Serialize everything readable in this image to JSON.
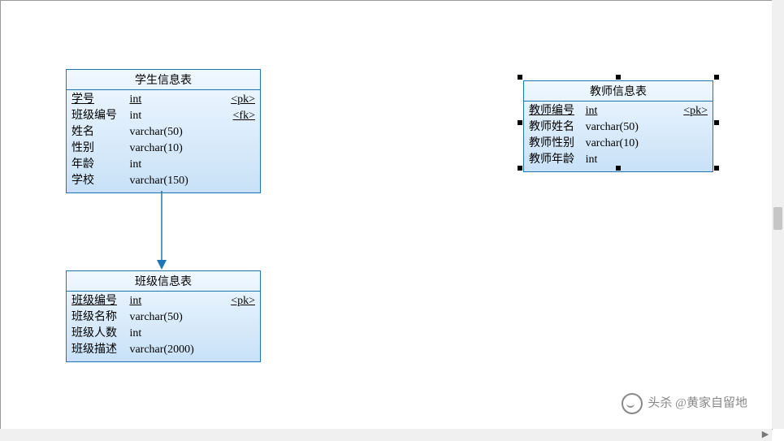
{
  "diagram": {
    "entities": {
      "student": {
        "title": "学生信息表",
        "cols": [
          {
            "name": "学号",
            "type": "int",
            "key": "<pk>",
            "is_key": true
          },
          {
            "name": "班级编号",
            "type": "int",
            "key": "<fk>",
            "is_key": false
          },
          {
            "name": "姓名",
            "type": "varchar(50)",
            "key": "",
            "is_key": false
          },
          {
            "name": "性别",
            "type": "varchar(10)",
            "key": "",
            "is_key": false
          },
          {
            "name": "年龄",
            "type": "int",
            "key": "",
            "is_key": false
          },
          {
            "name": "学校",
            "type": "varchar(150)",
            "key": "",
            "is_key": false
          }
        ]
      },
      "class": {
        "title": "班级信息表",
        "cols": [
          {
            "name": "班级编号",
            "type": "int",
            "key": "<pk>",
            "is_key": true
          },
          {
            "name": "班级名称",
            "type": "varchar(50)",
            "key": "",
            "is_key": false
          },
          {
            "name": "班级人数",
            "type": "int",
            "key": "",
            "is_key": false
          },
          {
            "name": "班级描述",
            "type": "varchar(2000)",
            "key": "",
            "is_key": false
          }
        ]
      },
      "teacher": {
        "title": "教师信息表",
        "cols": [
          {
            "name": "教师编号",
            "type": "int",
            "key": "<pk>",
            "is_key": true
          },
          {
            "name": "教师姓名",
            "type": "varchar(50)",
            "key": "",
            "is_key": false
          },
          {
            "name": "教师性别",
            "type": "varchar(10)",
            "key": "",
            "is_key": false
          },
          {
            "name": "教师年龄",
            "type": "int",
            "key": "",
            "is_key": false
          }
        ]
      }
    },
    "watermark": "头杀 @黄家自留地"
  }
}
